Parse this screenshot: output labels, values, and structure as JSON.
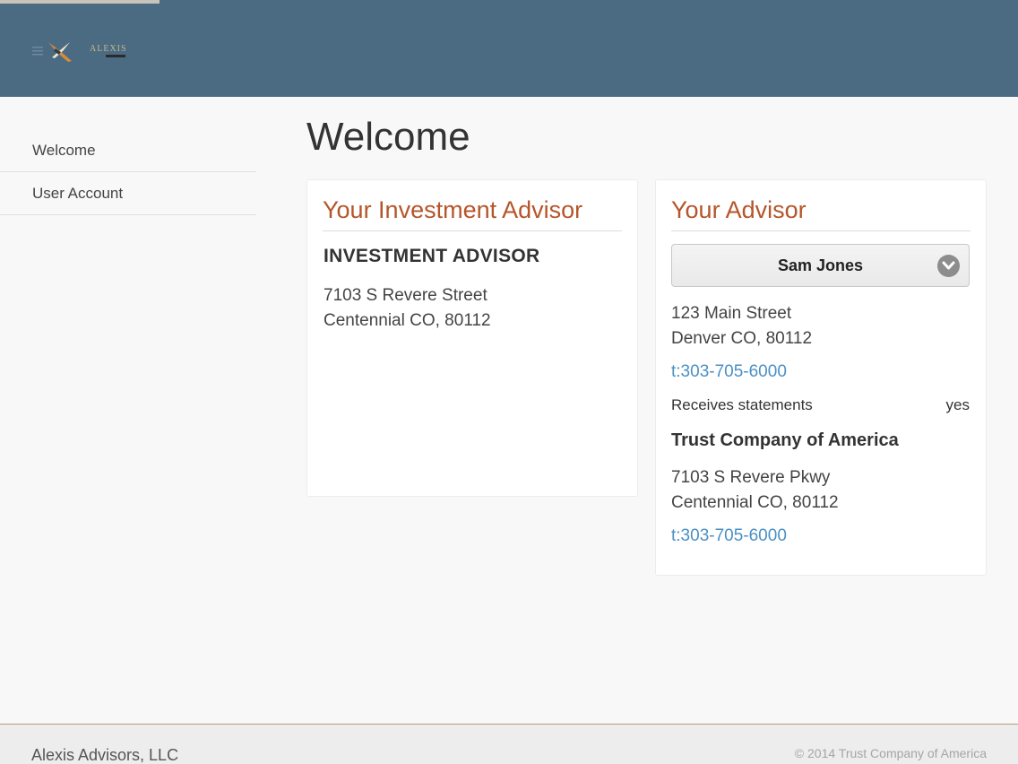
{
  "brand": {
    "logo_text": "ALEXIS",
    "accent_color": "#b5552a",
    "header_color": "#4a6b82",
    "link_color": "#4a90c4"
  },
  "sidebar": {
    "items": [
      {
        "label": "Welcome"
      },
      {
        "label": "User Account"
      }
    ]
  },
  "page": {
    "title": "Welcome"
  },
  "investment_advisor_card": {
    "title": "Your Investment Advisor",
    "firm_name": "INVESTMENT ADVISOR",
    "address_line1": "7103 S Revere Street",
    "address_line2": "Centennial CO, 80112"
  },
  "advisor_card": {
    "title": "Your Advisor",
    "selected_advisor": "Sam Jones",
    "address_line1": "123 Main Street",
    "address_line2": "Denver CO, 80112",
    "phone": "t:303-705-6000",
    "statements_label": "Receives statements",
    "statements_value": "yes",
    "trust_name": "Trust Company of America",
    "trust_address_line1": "7103 S Revere Pkwy",
    "trust_address_line2": "Centennial CO, 80112",
    "trust_phone": "t:303-705-6000"
  },
  "footer": {
    "company": "Alexis Advisors, LLC",
    "copyright": "© 2014 Trust Company of America"
  }
}
